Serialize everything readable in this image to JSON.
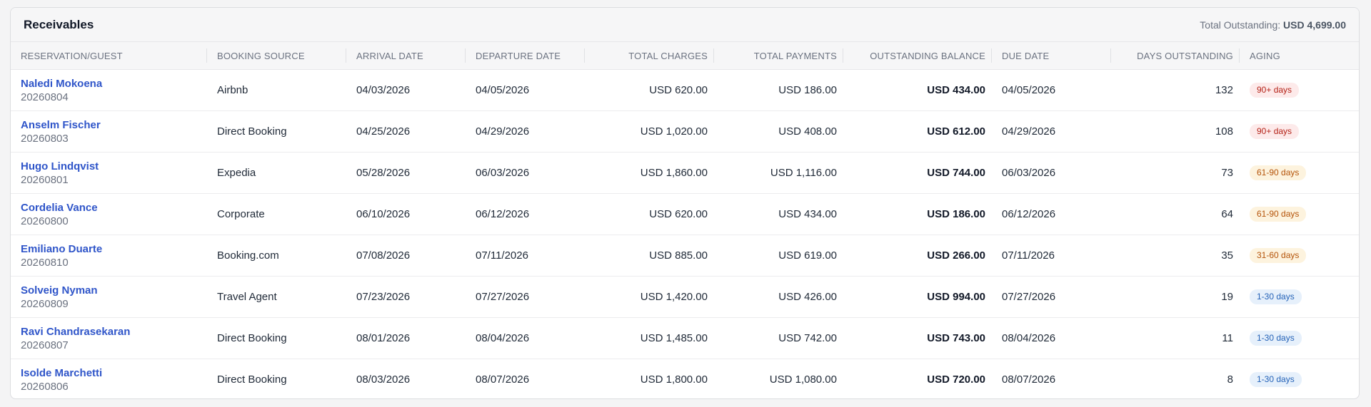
{
  "header": {
    "title": "Receivables",
    "total_label": "Total Outstanding:",
    "total_value": "USD 4,699.00"
  },
  "columns": [
    {
      "key": "guest",
      "label": "RESERVATION/GUEST"
    },
    {
      "key": "source",
      "label": "BOOKING SOURCE"
    },
    {
      "key": "arrival",
      "label": "ARRIVAL DATE"
    },
    {
      "key": "departure",
      "label": "DEPARTURE DATE"
    },
    {
      "key": "charges",
      "label": "TOTAL CHARGES"
    },
    {
      "key": "payments",
      "label": "TOTAL PAYMENTS"
    },
    {
      "key": "balance",
      "label": "OUTSTANDING BALANCE"
    },
    {
      "key": "due",
      "label": "DUE DATE"
    },
    {
      "key": "days",
      "label": "DAYS OUTSTANDING"
    },
    {
      "key": "aging",
      "label": "AGING"
    }
  ],
  "rows": [
    {
      "name": "Naledi Mokoena",
      "id": "20260804",
      "source": "Airbnb",
      "arrival": "04/03/2026",
      "departure": "04/05/2026",
      "charges": "USD 620.00",
      "payments": "USD 186.00",
      "balance": "USD 434.00",
      "due": "04/05/2026",
      "days": "132",
      "aging": "90+ days",
      "aging_level": "90"
    },
    {
      "name": "Anselm Fischer",
      "id": "20260803",
      "source": "Direct Booking",
      "arrival": "04/25/2026",
      "departure": "04/29/2026",
      "charges": "USD 1,020.00",
      "payments": "USD 408.00",
      "balance": "USD 612.00",
      "due": "04/29/2026",
      "days": "108",
      "aging": "90+ days",
      "aging_level": "90"
    },
    {
      "name": "Hugo Lindqvist",
      "id": "20260801",
      "source": "Expedia",
      "arrival": "05/28/2026",
      "departure": "06/03/2026",
      "charges": "USD 1,860.00",
      "payments": "USD 1,116.00",
      "balance": "USD 744.00",
      "due": "06/03/2026",
      "days": "73",
      "aging": "61-90 days",
      "aging_level": "61"
    },
    {
      "name": "Cordelia Vance",
      "id": "20260800",
      "source": "Corporate",
      "arrival": "06/10/2026",
      "departure": "06/12/2026",
      "charges": "USD 620.00",
      "payments": "USD 434.00",
      "balance": "USD 186.00",
      "due": "06/12/2026",
      "days": "64",
      "aging": "61-90 days",
      "aging_level": "61"
    },
    {
      "name": "Emiliano Duarte",
      "id": "20260810",
      "source": "Booking.com",
      "arrival": "07/08/2026",
      "departure": "07/11/2026",
      "charges": "USD 885.00",
      "payments": "USD 619.00",
      "balance": "USD 266.00",
      "due": "07/11/2026",
      "days": "35",
      "aging": "31-60 days",
      "aging_level": "31"
    },
    {
      "name": "Solveig Nyman",
      "id": "20260809",
      "source": "Travel Agent",
      "arrival": "07/23/2026",
      "departure": "07/27/2026",
      "charges": "USD 1,420.00",
      "payments": "USD 426.00",
      "balance": "USD 994.00",
      "due": "07/27/2026",
      "days": "19",
      "aging": "1-30 days",
      "aging_level": "1"
    },
    {
      "name": "Ravi Chandrasekaran",
      "id": "20260807",
      "source": "Direct Booking",
      "arrival": "08/01/2026",
      "departure": "08/04/2026",
      "charges": "USD 1,485.00",
      "payments": "USD 742.00",
      "balance": "USD 743.00",
      "due": "08/04/2026",
      "days": "11",
      "aging": "1-30 days",
      "aging_level": "1"
    },
    {
      "name": "Isolde Marchetti",
      "id": "20260806",
      "source": "Direct Booking",
      "arrival": "08/03/2026",
      "departure": "08/07/2026",
      "charges": "USD 1,800.00",
      "payments": "USD 1,080.00",
      "balance": "USD 720.00",
      "due": "08/07/2026",
      "days": "8",
      "aging": "1-30 days",
      "aging_level": "1"
    }
  ],
  "colors": {
    "link": "#2f55c9",
    "badge_90_bg": "#fdeaea",
    "badge_90_fg": "#b42318",
    "badge_61_bg": "#fdf3de",
    "badge_61_fg": "#b45309",
    "badge_1_bg": "#e6f0fb",
    "badge_1_fg": "#2563b8"
  }
}
